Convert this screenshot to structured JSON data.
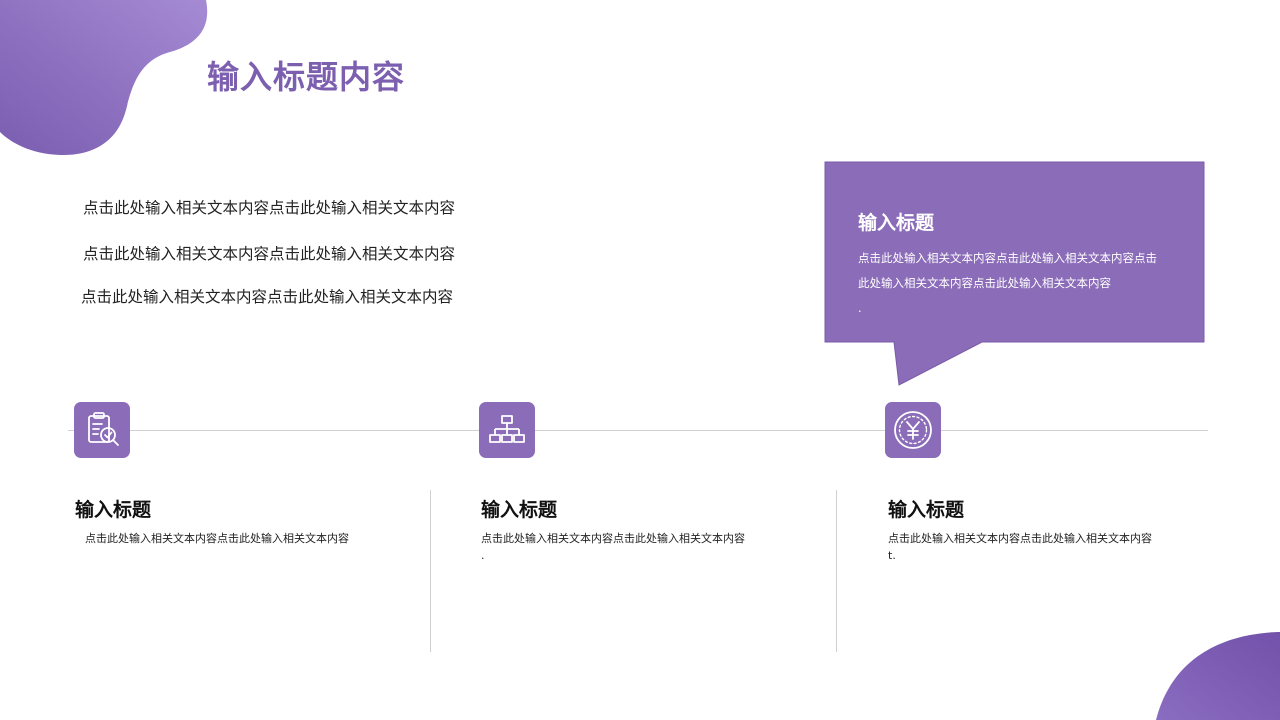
{
  "slide": {
    "title": "输入标题内容",
    "intro_lines": [
      "点击此处输入相关文本内容点击此处输入相关文本内容",
      "点击此处输入相关文本内容点击此处输入相关文本内容",
      "点击此处输入相关文本内容点击此处输入相关文本内容"
    ],
    "callout": {
      "title": "输入标题",
      "text": "点击此处输入相关文本内容点击此处输入相关文本内容点击此处输入相关文本内容点击此处输入相关文本内容\n."
    },
    "columns": [
      {
        "icon": "document-check-icon",
        "title": "输入标题",
        "text": "点击此处输入相关文本内容点击此处输入相关文本内容"
      },
      {
        "icon": "hierarchy-icon",
        "title": "输入标题",
        "text": "点击此处输入相关文本内容点击此处输入相关文本内容\n."
      },
      {
        "icon": "yen-coin-icon",
        "title": "输入标题",
        "text": "点击此处输入相关文本内容点击此处输入相关文本内容\nt."
      }
    ]
  },
  "colors": {
    "accent": "#8b6cb8",
    "title": "#7d5fb0",
    "blob": "#8f74c2"
  }
}
